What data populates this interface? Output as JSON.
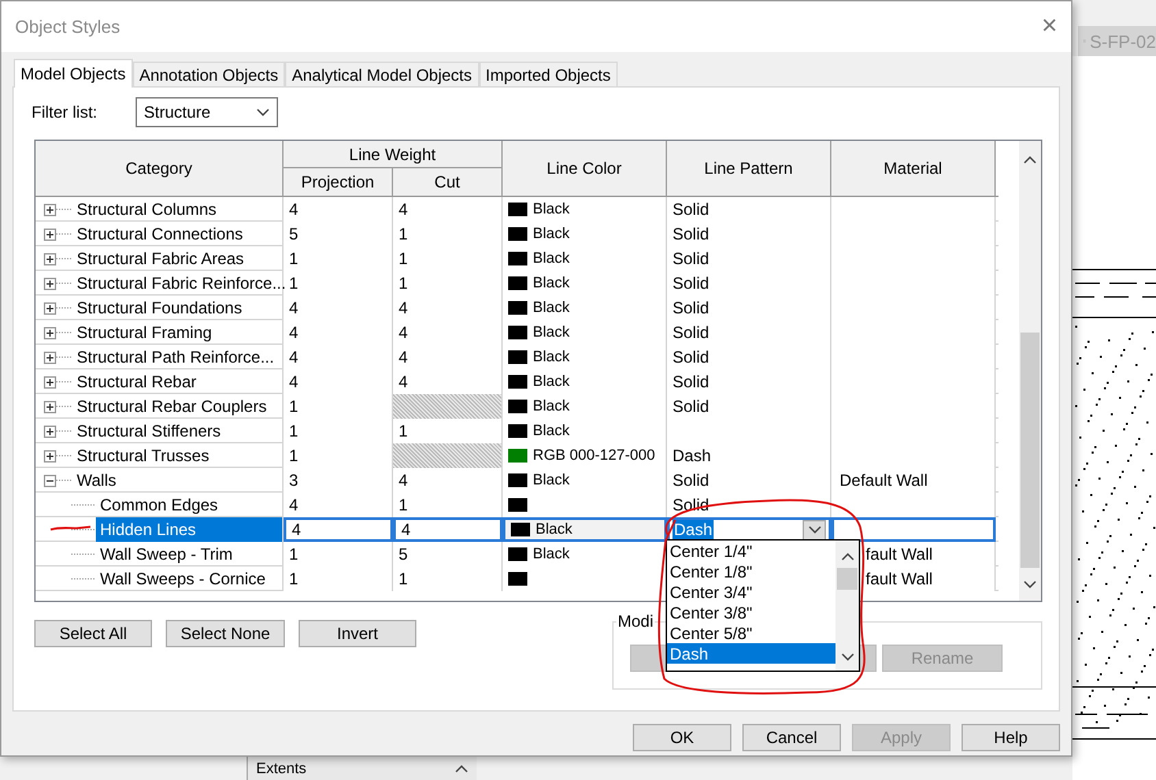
{
  "background": {
    "view_tab": "S-FP-02",
    "panel_title": "Extents"
  },
  "window": {
    "title": "Object Styles",
    "close": "×"
  },
  "tabs": [
    {
      "label": "Model Objects",
      "selected": true
    },
    {
      "label": "Annotation Objects",
      "selected": false
    },
    {
      "label": "Analytical Model Objects",
      "selected": false
    },
    {
      "label": "Imported Objects",
      "selected": false
    }
  ],
  "filter": {
    "label": "Filter list:",
    "value": "Structure"
  },
  "table": {
    "columns": {
      "category": "Category",
      "line_weight": "Line Weight",
      "projection": "Projection",
      "cut": "Cut",
      "line_color": "Line Color",
      "line_pattern": "Line Pattern",
      "material": "Material"
    },
    "rows": [
      {
        "name": "Structural Columns",
        "expanded": false,
        "selected": false,
        "projection": "4",
        "cut": "4",
        "color": "#000000",
        "color_label": "Black",
        "pattern": "Solid"
      },
      {
        "name": "Structural Connections",
        "expanded": false,
        "selected": false,
        "projection": "5",
        "cut": "1",
        "color": "#000000",
        "color_label": "Black",
        "pattern": "Solid"
      },
      {
        "name": "Structural Fabric Areas",
        "expanded": false,
        "selected": false,
        "projection": "1",
        "cut": "1",
        "color": "#000000",
        "color_label": "Black",
        "pattern": "Solid"
      },
      {
        "name": "Structural Fabric Reinforce...",
        "expanded": false,
        "selected": false,
        "projection": "1",
        "cut": "1",
        "color": "#000000",
        "color_label": "Black",
        "pattern": "Solid"
      },
      {
        "name": "Structural Foundations",
        "expanded": false,
        "selected": false,
        "projection": "4",
        "cut": "4",
        "color": "#000000",
        "color_label": "Black",
        "pattern": "Solid"
      },
      {
        "name": "Structural Framing",
        "expanded": false,
        "selected": false,
        "projection": "4",
        "cut": "4",
        "color": "#000000",
        "color_label": "Black",
        "pattern": "Solid"
      },
      {
        "name": "Structural Path Reinforce...",
        "expanded": false,
        "selected": false,
        "projection": "4",
        "cut": "4",
        "color": "#000000",
        "color_label": "Black",
        "pattern": "Solid"
      },
      {
        "name": "Structural Rebar",
        "expanded": false,
        "selected": false,
        "projection": "4",
        "cut": "4",
        "color": "#000000",
        "color_label": "Black",
        "pattern": "Solid"
      },
      {
        "name": "Structural Rebar Couplers",
        "expanded": false,
        "selected": false,
        "projection": "1",
        "color": "#000000",
        "color_label": "Black",
        "pattern": "Solid"
      },
      {
        "name": "Structural Stiffeners",
        "expanded": false,
        "selected": false,
        "projection": "1",
        "cut": "1",
        "color": "#000000",
        "color_label": "Black"
      },
      {
        "name": "Structural Trusses",
        "expanded": false,
        "selected": false,
        "projection": "1",
        "color": "#007f00",
        "color_label": "RGB 000-127-000",
        "pattern": "Dash"
      },
      {
        "name": "Walls",
        "expanded": true,
        "selected": false,
        "projection": "3",
        "cut": "4",
        "color": "#000000",
        "color_label": "Black",
        "pattern": "Solid",
        "material": "Default Wall",
        "children": [
          {
            "name": "Common Edges",
            "selected": false,
            "projection": "4",
            "cut": "1",
            "color": "#000000",
            "pattern": "Solid"
          },
          {
            "name": "Hidden Lines",
            "selected": true,
            "projection": "4",
            "cut": "4",
            "color": "#000000",
            "color_label": "Black",
            "pattern": "Dash"
          },
          {
            "name": "Wall Sweep - Trim",
            "selected": false,
            "projection": "1",
            "cut": "5",
            "color": "#000000",
            "color_label": "Black",
            "material": "fault Wall"
          },
          {
            "name": "Wall Sweeps - Cornice",
            "selected": false,
            "projection": "1",
            "cut": "1",
            "color": "#000000",
            "material": "fault Wall"
          }
        ]
      }
    ]
  },
  "pattern_dropdown": {
    "options": [
      {
        "label": "Center 1/4\"",
        "selected": false
      },
      {
        "label": "Center 1/8\"",
        "selected": false
      },
      {
        "label": "Center 3/4\"",
        "selected": false
      },
      {
        "label": "Center 3/8\"",
        "selected": false
      },
      {
        "label": "Center 5/8\"",
        "selected": false
      },
      {
        "label": "Dash",
        "selected": true
      }
    ]
  },
  "selection_buttons": [
    "Select All",
    "Select None",
    "Invert"
  ],
  "modify_group": {
    "label": "Modi",
    "buttons": [
      {
        "disabled": true
      },
      {
        "disabled": true
      },
      {
        "label": "Rename",
        "disabled": true
      }
    ]
  },
  "dialog_buttons": [
    {
      "label": "OK",
      "disabled": false
    },
    {
      "label": "Cancel",
      "disabled": false
    },
    {
      "label": "Apply",
      "disabled": true
    },
    {
      "label": "Help",
      "disabled": false
    }
  ]
}
